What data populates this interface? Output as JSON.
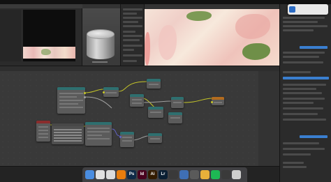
{
  "notification": {
    "title": "",
    "body": ""
  },
  "node_editor": {
    "footer_text": ""
  },
  "dock": {
    "items": [
      {
        "name": "finder",
        "glyph": "",
        "color": "#4a8de0"
      },
      {
        "name": "photos",
        "glyph": "",
        "color": "#e0e0e0"
      },
      {
        "name": "chrome",
        "glyph": "",
        "color": "#dcdcdc"
      },
      {
        "name": "blender",
        "glyph": "",
        "color": "#e87d0d"
      },
      {
        "name": "photoshop",
        "glyph": "Ps",
        "color": "#0f2a47"
      },
      {
        "name": "indesign",
        "glyph": "Id",
        "color": "#49021f"
      },
      {
        "name": "illustrator",
        "glyph": "Ai",
        "color": "#331c00"
      },
      {
        "name": "lightroom",
        "glyph": "Lr",
        "color": "#0a1f33"
      },
      {
        "name": "app-9",
        "glyph": "",
        "color": "#3a3a3a"
      },
      {
        "name": "app-10",
        "glyph": "",
        "color": "#3f6fb5"
      },
      {
        "name": "app-11",
        "glyph": "",
        "color": "#5a5a5a"
      },
      {
        "name": "app-12",
        "glyph": "",
        "color": "#e8b03a"
      },
      {
        "name": "spotify",
        "glyph": "",
        "color": "#1db954"
      },
      {
        "name": "app-14",
        "glyph": "",
        "color": "#3a3a3a"
      },
      {
        "name": "app-15",
        "glyph": "",
        "color": "#cfcfcf"
      }
    ]
  }
}
